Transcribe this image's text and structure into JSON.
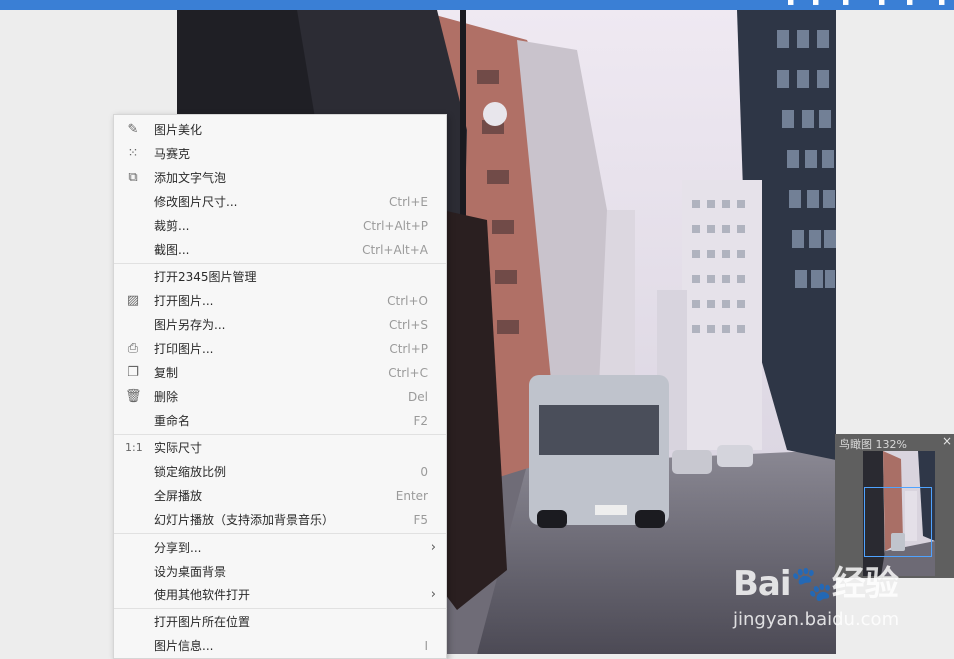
{
  "menu": {
    "items": [
      {
        "label": "图片美化",
        "shortcut": "",
        "icon": "edit-icon",
        "glyph": "✎"
      },
      {
        "label": "马赛克",
        "shortcut": "",
        "icon": "mosaic-icon",
        "glyph": "⁙"
      },
      {
        "label": "添加文字气泡",
        "shortcut": "",
        "icon": "text-bubble-icon",
        "glyph": "⧉"
      },
      {
        "label": "修改图片尺寸...",
        "shortcut": "Ctrl+E",
        "icon": "",
        "glyph": ""
      },
      {
        "label": "裁剪...",
        "shortcut": "Ctrl+Alt+P",
        "icon": "",
        "glyph": ""
      },
      {
        "label": "截图...",
        "shortcut": "Ctrl+Alt+A",
        "icon": "",
        "glyph": ""
      },
      {
        "label": "打开2345图片管理",
        "shortcut": "",
        "icon": "",
        "glyph": ""
      },
      {
        "label": "打开图片...",
        "shortcut": "Ctrl+O",
        "icon": "image-icon",
        "glyph": "▨"
      },
      {
        "label": "图片另存为...",
        "shortcut": "Ctrl+S",
        "icon": "",
        "glyph": ""
      },
      {
        "label": "打印图片...",
        "shortcut": "Ctrl+P",
        "icon": "printer-icon",
        "glyph": "⎙"
      },
      {
        "label": "复制",
        "shortcut": "Ctrl+C",
        "icon": "copy-icon",
        "glyph": "❐"
      },
      {
        "label": "删除",
        "shortcut": "Del",
        "icon": "trash-icon",
        "glyph": "🗑"
      },
      {
        "label": "重命名",
        "shortcut": "F2",
        "icon": "",
        "glyph": ""
      },
      {
        "label": "实际尺寸",
        "shortcut": "",
        "icon": "actual-size-icon",
        "glyph": "1:1"
      },
      {
        "label": "锁定缩放比例",
        "shortcut": "0",
        "icon": "",
        "glyph": ""
      },
      {
        "label": "全屏播放",
        "shortcut": "Enter",
        "icon": "",
        "glyph": ""
      },
      {
        "label": "幻灯片播放（支持添加背景音乐）",
        "shortcut": "F5",
        "icon": "",
        "glyph": ""
      },
      {
        "label": "分享到...",
        "shortcut": "",
        "icon": "",
        "glyph": "",
        "submenu": true
      },
      {
        "label": "设为桌面背景",
        "shortcut": "",
        "icon": "",
        "glyph": ""
      },
      {
        "label": "使用其他软件打开",
        "shortcut": "",
        "icon": "",
        "glyph": "",
        "submenu": true
      },
      {
        "label": "打开图片所在位置",
        "shortcut": "",
        "icon": "",
        "glyph": ""
      },
      {
        "label": "图片信息...",
        "shortcut": "I",
        "icon": "",
        "glyph": ""
      }
    ],
    "submenu_arrow": "›"
  },
  "navigator": {
    "title": "鸟瞰图 132%",
    "close_glyph": "×"
  },
  "watermark": {
    "logo": "Bai🐾经验",
    "url": "jingyan.baidu.com"
  },
  "colors": {
    "titlebar": "#3a7fd5",
    "menu_bg": "#f7f7f7",
    "viewport_border": "#4fa3ff"
  }
}
